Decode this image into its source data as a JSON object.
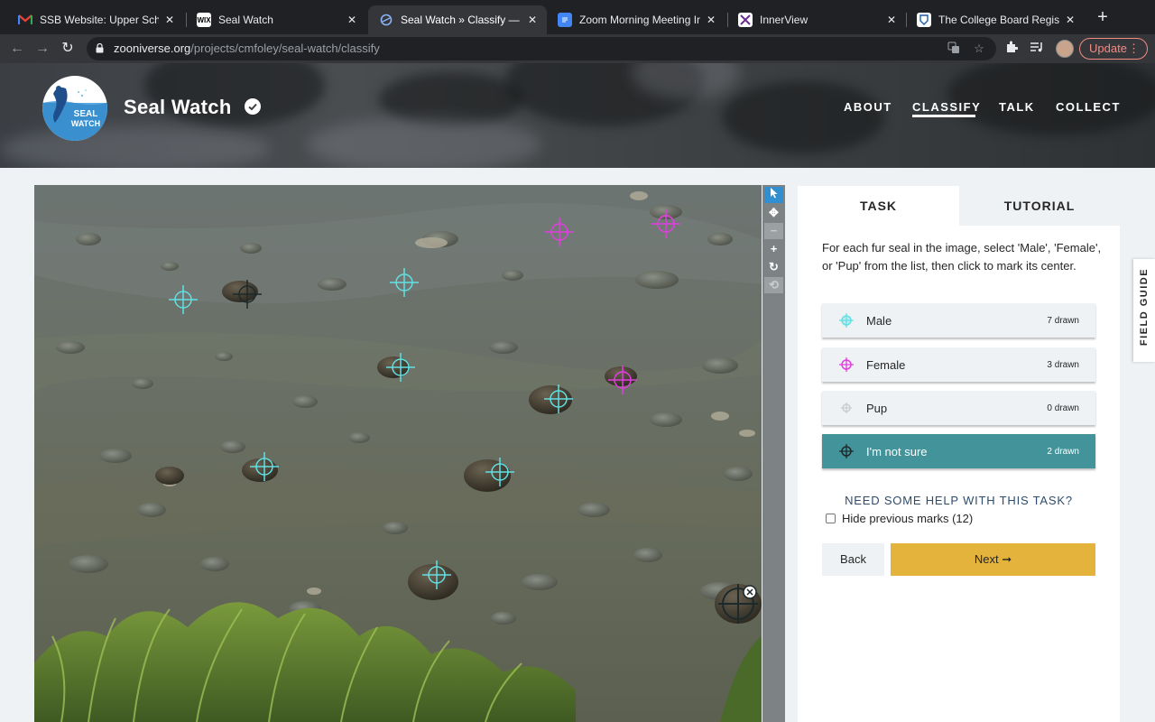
{
  "browser": {
    "tabs": [
      {
        "title": "SSB Website: Upper School",
        "favicon": "gmail-icon",
        "active": false
      },
      {
        "title": "Seal Watch",
        "favicon": "wix-icon",
        "active": false
      },
      {
        "title": "Seal Watch » Classify — Zooniverse",
        "favicon": "zooniverse-icon",
        "active": true
      },
      {
        "title": "Zoom Morning Meeting Information",
        "favicon": "docs-icon",
        "active": false
      },
      {
        "title": "InnerView",
        "favicon": "innerview-icon",
        "active": false
      },
      {
        "title": "The College Board Registration",
        "favicon": "college-board-icon",
        "active": false
      }
    ],
    "url_host": "zooniverse.org",
    "url_path": "/projects/cmfoley/seal-watch/classify",
    "update_label": "Update"
  },
  "site": {
    "logo_line1": "SEAL",
    "logo_line2": "WATCH",
    "title": "Seal Watch",
    "nav": [
      {
        "label": "ABOUT",
        "active": false
      },
      {
        "label": "CLASSIFY",
        "active": true
      },
      {
        "label": "TALK",
        "active": false
      },
      {
        "label": "COLLECT",
        "active": false
      }
    ]
  },
  "tools": [
    "pointer-tool-icon",
    "move-tool-icon",
    "zoom-out-icon",
    "zoom-in-icon",
    "rotate-icon",
    "reset-icon"
  ],
  "panel": {
    "tabs": {
      "task": "TASK",
      "tutorial": "TUTORIAL"
    },
    "instruction": "For each fur seal in the image, select 'Male', 'Female', or 'Pup' from the list, then click to mark its center.",
    "choices": [
      {
        "label": "Male",
        "count": "7 drawn",
        "color": "#62dfe3",
        "selected": false
      },
      {
        "label": "Female",
        "count": "3 drawn",
        "color": "#e23ee0",
        "selected": false
      },
      {
        "label": "Pup",
        "count": "0 drawn",
        "color": "#c9cdd0",
        "selected": false
      },
      {
        "label": "I'm not sure",
        "count": "2 drawn",
        "color": "#1d2a2b",
        "selected": true
      }
    ],
    "help_link": "NEED SOME HELP WITH THIS TASK?",
    "hide_marks_label": "Hide previous marks (12)",
    "back_label": "Back",
    "next_label": "Next ➞"
  },
  "field_guide_label": "FIELD GUIDE",
  "colors": {
    "male_mark": "#62dfe3",
    "female_mark": "#e23ee0",
    "unsure_mark": "#1d2a2b",
    "selected_choice": "#43949a",
    "next_button": "#e4b33b"
  }
}
